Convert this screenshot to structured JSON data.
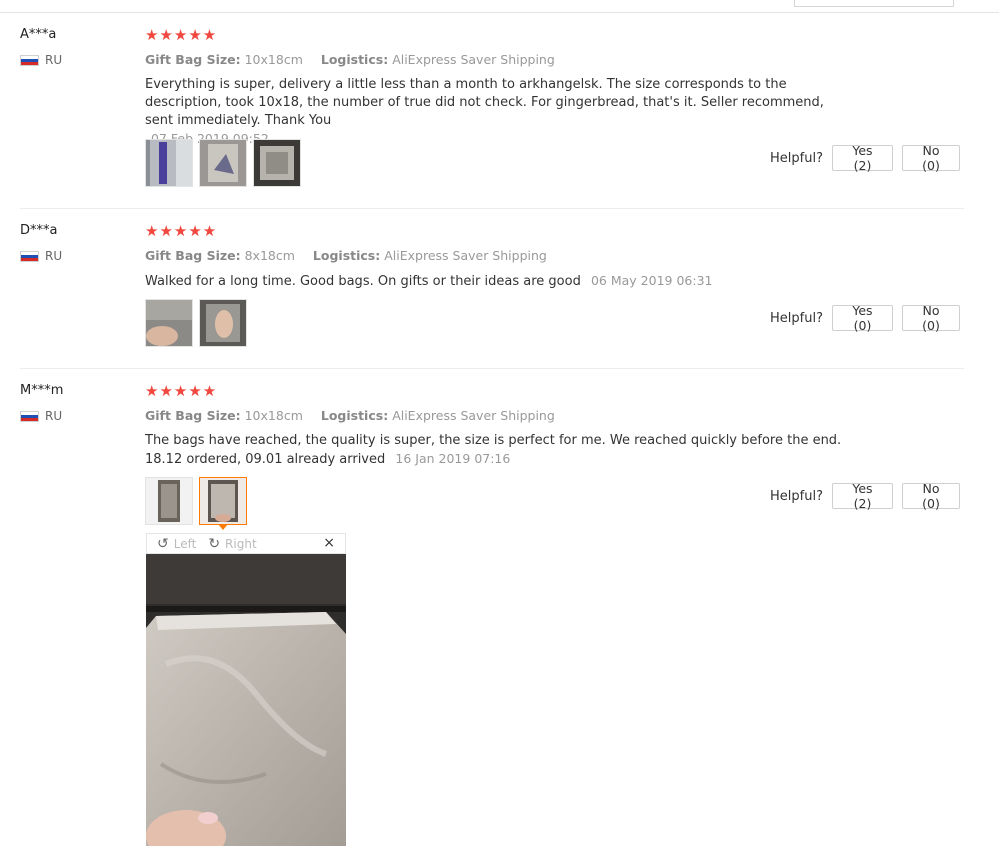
{
  "helpful_label": "Helpful?",
  "reviews": [
    {
      "user": "A***a",
      "country": "RU",
      "stars": "★★★★★",
      "attr1_label": "Gift Bag Size:",
      "attr1_value": "10x18cm",
      "attr2_label": "Logistics:",
      "attr2_value": "AliExpress Saver Shipping",
      "text": "Everything is super, delivery a little less than a month to arkhangelsk. The size corresponds to the description, took 10x18, the number of true did not check. For gingerbread, that's it. Seller recommend, sent immediately. Thank You",
      "date": "07 Feb 2019 09:52",
      "yes": "Yes (2)",
      "no": "No (0)"
    },
    {
      "user": "D***a",
      "country": "RU",
      "stars": "★★★★★",
      "attr1_label": "Gift Bag Size:",
      "attr1_value": "8x18cm",
      "attr2_label": "Logistics:",
      "attr2_value": "AliExpress Saver Shipping",
      "text": "Walked for a long time. Good bags. On gifts or their ideas are good",
      "date": "06 May 2019 06:31",
      "yes": "Yes (0)",
      "no": "No (0)"
    },
    {
      "user": "M***m",
      "country": "RU",
      "stars": "★★★★★",
      "attr1_label": "Gift Bag Size:",
      "attr1_value": "10x18cm",
      "attr2_label": "Logistics:",
      "attr2_value": "AliExpress Saver Shipping",
      "text": "The bags have reached, the quality is super, the size is perfect for me. We reached quickly before the end. 18.12 ordered, 09.01 already arrived",
      "date": "16 Jan 2019 07:16",
      "yes": "Yes (2)",
      "no": "No (0)"
    }
  ],
  "viewer": {
    "rotate_left": "Left",
    "rotate_right": "Right",
    "close_icon": "×",
    "rotate_left_icon": "↺",
    "rotate_right_icon": "↻"
  },
  "colors": {
    "star": "#f0483e",
    "active_thumb_border": "#ff7a00"
  }
}
